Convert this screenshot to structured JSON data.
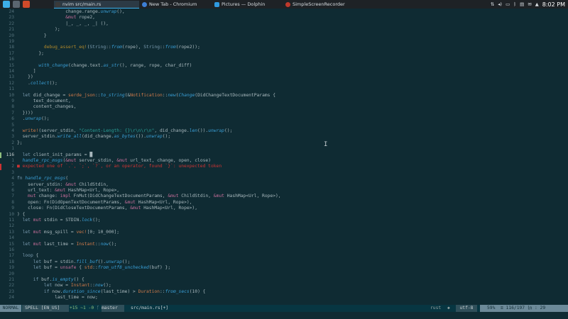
{
  "taskbar": {
    "tasks": [
      {
        "label": "nvim src/main.rs",
        "icon_color": "#3a3a3a"
      },
      {
        "label": "New Tab - Chromium",
        "icon_color": "#3d7fd6"
      },
      {
        "label": "Pictures — Dolphin",
        "icon_color": "#2f9ae0"
      },
      {
        "label": "SimpleScreenRecorder",
        "icon_color": "#c0392b"
      }
    ],
    "clock": "8:02 PM"
  },
  "editor": {
    "lines": [
      {
        "n": "24",
        "segs": [
          [
            "t",
            "                  change.range."
          ],
          [
            "f",
            "unwrap"
          ],
          [
            "t",
            "(),"
          ]
        ]
      },
      {
        "n": "23",
        "segs": [
          [
            "t",
            "                  "
          ],
          [
            "p",
            "&mut"
          ],
          [
            "t",
            " rope2,"
          ]
        ]
      },
      {
        "n": "22",
        "segs": [
          [
            "t",
            "                  |_, _, _, _| (),"
          ]
        ]
      },
      {
        "n": "21",
        "segs": [
          [
            "t",
            "              );"
          ]
        ]
      },
      {
        "n": "20",
        "segs": [
          [
            "t",
            "          }"
          ]
        ]
      },
      {
        "n": "19",
        "segs": []
      },
      {
        "n": "18",
        "segs": [
          [
            "t",
            "          "
          ],
          [
            "o",
            "debug_assert_eq!"
          ],
          [
            "t",
            "("
          ],
          [
            "k",
            "String"
          ],
          [
            "t",
            "::"
          ],
          [
            "f",
            "from"
          ],
          [
            "t",
            "(rope), "
          ],
          [
            "k",
            "String"
          ],
          [
            "t",
            "::"
          ],
          [
            "f",
            "from"
          ],
          [
            "t",
            "(rope2));"
          ]
        ]
      },
      {
        "n": "17",
        "segs": [
          [
            "t",
            "        };"
          ]
        ]
      },
      {
        "n": "16",
        "segs": []
      },
      {
        "n": "15",
        "segs": [
          [
            "t",
            "        "
          ],
          [
            "f",
            "with_change"
          ],
          [
            "t",
            "(change.text."
          ],
          [
            "f",
            "as_str"
          ],
          [
            "t",
            "(), range, rope, char_diff)"
          ]
        ]
      },
      {
        "n": "14",
        "segs": [
          [
            "t",
            "      ]"
          ]
        ]
      },
      {
        "n": "13",
        "segs": [
          [
            "t",
            "    })"
          ]
        ]
      },
      {
        "n": "12",
        "segs": [
          [
            "t",
            "    ."
          ],
          [
            "f",
            "collect"
          ],
          [
            "t",
            "();"
          ]
        ]
      },
      {
        "n": "11",
        "segs": []
      },
      {
        "n": "10",
        "segs": [
          [
            "t",
            "  "
          ],
          [
            "k",
            "let"
          ],
          [
            "t",
            " did_change = "
          ],
          [
            "m",
            "serde_json"
          ],
          [
            "t",
            "::"
          ],
          [
            "f",
            "to_string"
          ],
          [
            "t",
            "(&"
          ],
          [
            "m",
            "Notification"
          ],
          [
            "t",
            "::"
          ],
          [
            "f",
            "new"
          ],
          [
            "t",
            "("
          ],
          [
            "f",
            "Change"
          ],
          [
            "t",
            "(DidChangeTextDocumentParams {"
          ]
        ]
      },
      {
        "n": "9",
        "segs": [
          [
            "t",
            "      text_document,"
          ]
        ]
      },
      {
        "n": "8",
        "segs": [
          [
            "t",
            "      content_changes,"
          ]
        ]
      },
      {
        "n": "7",
        "segs": [
          [
            "t",
            "  })))"
          ]
        ]
      },
      {
        "n": "6",
        "segs": [
          [
            "t",
            "  ."
          ],
          [
            "f",
            "unwrap"
          ],
          [
            "t",
            "();"
          ]
        ]
      },
      {
        "n": "5",
        "segs": []
      },
      {
        "n": "4",
        "segs": [
          [
            "t",
            "  "
          ],
          [
            "m",
            "write!"
          ],
          [
            "t",
            "(server_stdin, "
          ],
          [
            "s",
            "\"Content-Length: {}\\r\\n\\r\\n\""
          ],
          [
            "t",
            ", did_change."
          ],
          [
            "f",
            "len"
          ],
          [
            "t",
            "())."
          ],
          [
            "f",
            "unwrap"
          ],
          [
            "t",
            "();"
          ]
        ]
      },
      {
        "n": "3",
        "segs": [
          [
            "t",
            "  server_stdin."
          ],
          [
            "f",
            "write_all"
          ],
          [
            "t",
            "(did_change."
          ],
          [
            "f",
            "as_bytes"
          ],
          [
            "t",
            "())."
          ],
          [
            "f",
            "unwrap"
          ],
          [
            "t",
            "();"
          ]
        ]
      },
      {
        "n": "2",
        "segs": [
          [
            "t",
            "};"
          ]
        ]
      },
      {
        "n": "1",
        "segs": []
      },
      {
        "n": "116",
        "cur": true,
        "segs": [
          [
            "t",
            "  "
          ],
          [
            "k",
            "let"
          ],
          [
            "t",
            " client_init_params = "
          ],
          [
            "t",
            "█"
          ]
        ]
      },
      {
        "n": "1",
        "segs": [
          [
            "t",
            "  "
          ],
          [
            "f",
            "handle_rpc_msgs"
          ],
          [
            "t",
            "("
          ],
          [
            "p",
            "&mut"
          ],
          [
            "t",
            " server_stdin, "
          ],
          [
            "p",
            "&mut"
          ],
          [
            "t",
            " url_text, change, open, close)"
          ]
        ]
      },
      {
        "n": "2",
        "err": true,
        "segs": [
          [
            "e",
            "■ expected one of `.`, `;`, `?`, or an operator, found `}`: unexpected token"
          ]
        ]
      },
      {
        "n": "3",
        "segs": []
      },
      {
        "n": "4",
        "segs": [
          [
            "k",
            "fn"
          ],
          [
            "t",
            " "
          ],
          [
            "f",
            "handle_rpc_msgs"
          ],
          [
            "t",
            "("
          ]
        ]
      },
      {
        "n": "5",
        "segs": [
          [
            "t",
            "    server_stdin: "
          ],
          [
            "p",
            "&mut"
          ],
          [
            "t",
            " ChildStdin,"
          ]
        ]
      },
      {
        "n": "6",
        "segs": [
          [
            "t",
            "    url_text: "
          ],
          [
            "p",
            "&mut"
          ],
          [
            "t",
            " HashMap<Url, Rope>,"
          ]
        ]
      },
      {
        "n": "7",
        "segs": [
          [
            "t",
            "    "
          ],
          [
            "p",
            "mut"
          ],
          [
            "t",
            " change: "
          ],
          [
            "p",
            "impl"
          ],
          [
            "t",
            " FnMut(DidChangeTextDocumentParams, "
          ],
          [
            "p",
            "&mut"
          ],
          [
            "t",
            " ChildStdin, "
          ],
          [
            "p",
            "&mut"
          ],
          [
            "t",
            " HashMap<Url, Rope>),"
          ]
        ]
      },
      {
        "n": "8",
        "segs": [
          [
            "t",
            "    open: Fn(DidOpenTextDocumentParams, "
          ],
          [
            "p",
            "&mut"
          ],
          [
            "t",
            " HashMap<Url, Rope>),"
          ]
        ]
      },
      {
        "n": "9",
        "segs": [
          [
            "t",
            "    close: Fn(DidCloseTextDocumentParams, "
          ],
          [
            "p",
            "&mut"
          ],
          [
            "t",
            " HashMap<Url, Rope>),"
          ]
        ]
      },
      {
        "n": "10",
        "segs": [
          [
            "t",
            ") {"
          ]
        ]
      },
      {
        "n": "11",
        "segs": [
          [
            "t",
            "  "
          ],
          [
            "k",
            "let"
          ],
          [
            "t",
            " "
          ],
          [
            "p",
            "mut"
          ],
          [
            "t",
            " stdin = STDIN."
          ],
          [
            "f",
            "lock"
          ],
          [
            "t",
            "();"
          ]
        ]
      },
      {
        "n": "12",
        "segs": []
      },
      {
        "n": "13",
        "segs": [
          [
            "t",
            "  "
          ],
          [
            "k",
            "let"
          ],
          [
            "t",
            " "
          ],
          [
            "p",
            "mut"
          ],
          [
            "t",
            " msg_spill = "
          ],
          [
            "m",
            "vec!"
          ],
          [
            "t",
            "[0; 10_000];"
          ]
        ]
      },
      {
        "n": "14",
        "segs": []
      },
      {
        "n": "15",
        "segs": [
          [
            "t",
            "  "
          ],
          [
            "k",
            "let"
          ],
          [
            "t",
            " "
          ],
          [
            "p",
            "mut"
          ],
          [
            "t",
            " last_time = "
          ],
          [
            "m",
            "Instant"
          ],
          [
            "t",
            "::"
          ],
          [
            "f",
            "now"
          ],
          [
            "t",
            "();"
          ]
        ]
      },
      {
        "n": "16",
        "segs": []
      },
      {
        "n": "17",
        "segs": [
          [
            "t",
            "  "
          ],
          [
            "k",
            "loop"
          ],
          [
            "t",
            " {"
          ]
        ]
      },
      {
        "n": "18",
        "segs": [
          [
            "t",
            "      "
          ],
          [
            "k",
            "let"
          ],
          [
            "t",
            " buf = stdin."
          ],
          [
            "f",
            "fill_buf"
          ],
          [
            "t",
            "()."
          ],
          [
            "f",
            "unwrap"
          ],
          [
            "t",
            "();"
          ]
        ]
      },
      {
        "n": "19",
        "segs": [
          [
            "t",
            "      "
          ],
          [
            "k",
            "let"
          ],
          [
            "t",
            " buf = "
          ],
          [
            "p",
            "unsafe"
          ],
          [
            "t",
            " { "
          ],
          [
            "m",
            "std"
          ],
          [
            "t",
            "::"
          ],
          [
            "f",
            "from_utf8_unchecked"
          ],
          [
            "t",
            "(buf) };"
          ]
        ]
      },
      {
        "n": "20",
        "segs": []
      },
      {
        "n": "21",
        "segs": [
          [
            "t",
            "      "
          ],
          [
            "k",
            "if"
          ],
          [
            "t",
            " buf."
          ],
          [
            "f",
            "is_empty"
          ],
          [
            "t",
            "() {"
          ]
        ]
      },
      {
        "n": "22",
        "segs": [
          [
            "t",
            "          "
          ],
          [
            "k",
            "let"
          ],
          [
            "t",
            " now = "
          ],
          [
            "m",
            "Instant"
          ],
          [
            "t",
            "::"
          ],
          [
            "f",
            "now"
          ],
          [
            "t",
            "();"
          ]
        ]
      },
      {
        "n": "23",
        "segs": [
          [
            "t",
            "          "
          ],
          [
            "k",
            "if"
          ],
          [
            "t",
            " now."
          ],
          [
            "f",
            "duration_since"
          ],
          [
            "t",
            "(last_time) > "
          ],
          [
            "m",
            "Duration"
          ],
          [
            "t",
            "::"
          ],
          [
            "f",
            "from_secs"
          ],
          [
            "t",
            "(10) {"
          ]
        ]
      },
      {
        "n": "24",
        "segs": [
          [
            "t",
            "              last_time = now;"
          ]
        ]
      }
    ]
  },
  "statusline": {
    "mode": "NORMAL",
    "spell": "SPELL [EN_US]",
    "git_diff": "+15 ~1 -0",
    "branch": "master",
    "file": "src/main.rs[+]",
    "filetype": "rust",
    "encoding": "utf-8",
    "position": "59%  ≡ 116/197 ㏑ : 29"
  },
  "colors": {
    "background": "#0f2b33",
    "mode_bg": "#6c8a99",
    "error": "#cc3333"
  }
}
